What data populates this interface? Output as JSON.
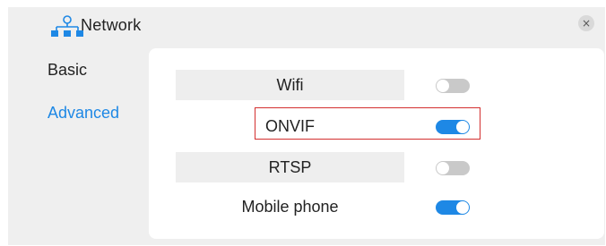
{
  "header": {
    "icon": "network-icon",
    "title": "Network",
    "close_icon": "close-icon",
    "close_symbol": "×"
  },
  "nav": {
    "items": [
      {
        "label": "Basic",
        "active": false
      },
      {
        "label": "Advanced",
        "active": true
      }
    ]
  },
  "settings": {
    "rows": [
      {
        "label": "Wifi",
        "enabled": false
      },
      {
        "label": "ONVIF",
        "enabled": true,
        "highlighted": true
      },
      {
        "label": "RTSP",
        "enabled": false
      },
      {
        "label": "Mobile phone",
        "enabled": true
      }
    ]
  },
  "colors": {
    "accent": "#1e88e5",
    "toggle_off": "#c9c9c9",
    "highlight_border": "#d32f2f",
    "window_bg": "#efefef"
  }
}
